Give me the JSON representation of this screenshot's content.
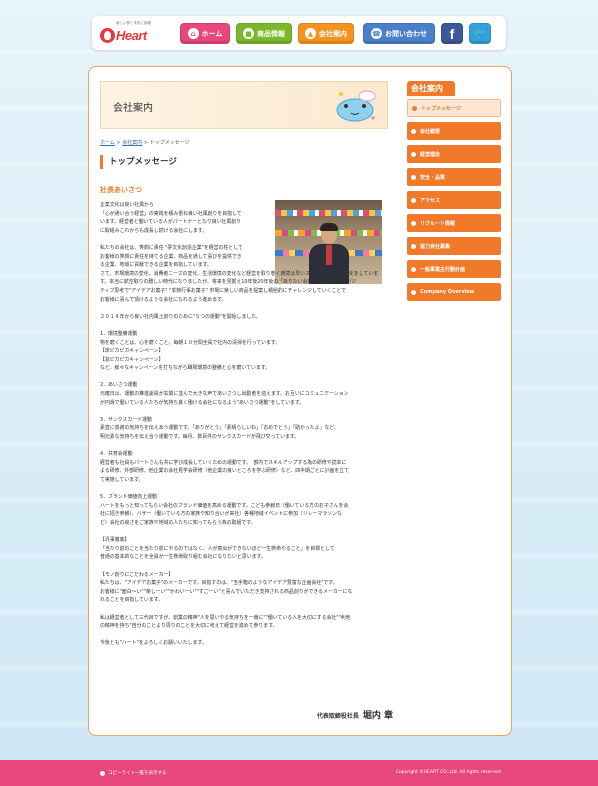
{
  "header": {
    "logo_tagline": "楽しい夢と未来に挑戦",
    "logo_text": "Heart",
    "nav": [
      {
        "label": "ホーム",
        "icon": "house-icon"
      },
      {
        "label": "商品情報",
        "icon": "box-icon"
      },
      {
        "label": "会社案内",
        "icon": "building-icon"
      },
      {
        "label": "お問い合わせ",
        "icon": "phone-icon"
      }
    ],
    "facebook_label": "f",
    "twitter_label": "t"
  },
  "page": {
    "title": "会社案内",
    "breadcrumb": [
      "ホーム",
      "会社案内",
      "トップメッセージ"
    ],
    "section_title": "トップメッセージ",
    "greeting_title": "社長あいさつ"
  },
  "message": {
    "intro_lines": [
      "企業文化は良い社風から",
      "「心が通い合う経営」の実践を積み重ね良い社風創りを目指して",
      "います。経営者と働いている人がパートナーとなり良い社風創り",
      "に取組みこれからも成長し続ける会社にします。"
    ],
    "vision_lines": [
      "私たちの会社は、笑顔に責任 \"夢文化創造企業\"を経営の柱として",
      "お客様の笑顔に責任を持てる企業、商品を通して喜びを提供でき",
      "る企業、地域に貢献できる企業を目指しています。",
      "さて、市場環境の変化、消費者ニーズの変化、生活環境の変化など経営を取り巻く環境は早いスピードで大きく変化をしていま",
      "す。本当に航空取りの難しい時代になりましたが、将来を見据え10年後20年後の「ありたい会社像」に向かってポジ",
      "ティブ思考で\"アイデアお菓子\" \"季節行事お菓子\" 市場に楽しい商品を提案し積極的にチャレンジしていくことで",
      "お客様に喜んで頂けるような会社になれるよう進めます。"
    ],
    "campaign_intro": "２０１４年から良い社内風土創りのために\"５つの運動\"を開始しました。",
    "movements": [
      {
        "title": "1．環境整備運動",
        "lines": [
          "物を磨くことは、心を磨くこと。毎朝１０分間全員で社内の清掃を行っています。",
          "【床ピカピカキャンペーン】",
          "【窓ピカピカキャンペーン】",
          "など、様々なキャンペーンを打ちながら職場環境の整備と心を磨いています。"
        ]
      },
      {
        "title": "2．あいさつ運動",
        "lines": [
          "元確日は、運動の推進委員が玄関に並んで大きな声であいさつし出勤者を迎えます。お互いにコミュニケーション",
          "が円滑で働いている人たちが気持ち良く働ける会社になるよう\"あいさつ運動\"をしています。"
        ]
      },
      {
        "title": "3．サンクスカード運動",
        "lines": [
          "素直に感謝の気持ちを伝えあう運動です。「ありがとう」「素晴らしいね」「おめでとう」「助かったよ」など、",
          "明元素な気持ちを伝え合う運動です。毎月、数百件のサンクスカードが飛び交っています。"
        ]
      },
      {
        "title": "4．共育会運動",
        "lines": [
          "経営者も社員もパートさんも共に学び成長していくための運動です。　部内でスキルアップする為の研修や読本に",
          "よる研修、外部研修、他企業の会社見学会研修（他企業の良いところを学ぶ研修）など、四半期ごとに計画を立て",
          "て実施しています。"
        ]
      },
      {
        "title": "5．ブランド価値向上運動",
        "lines": [
          "ハートをもっと知ってもらい会社のブランド価値を高める運動です。こども参観日（働いている方のお子さんを会",
          "社に招き参観）、バザー（働いている方の家族や知り合いが来社）各種地域イベントに参加（リレーマラソンな",
          "ど）会社の良さをご家族や地域の人たちに知ってもらう為の取組です。"
        ]
      }
    ],
    "motto_blocks": [
      {
        "title": "【汎事徹底】",
        "lines": [
          "「当たり前のことを当たり前にやるのではなく、人が真似ができないほど一生懸命やること」を目標として",
          "普通の基本的なことを全員が一生懸命取り組む会社になりたいと思います。"
        ]
      },
      {
        "title": "【モノ創りにこだわるメーカー】",
        "lines": [
          "私たちは、\"アイデアお菓子\"のメーカーです。目指すのは、\"玉手箱のようなアイデア豊富な企画会社\"です。",
          "お客様に\"面白〜い\"\"楽しーい\"\"かわいーい\"\"すごーい\"と喜んでいただき支持される商品創りができるメーカーにな",
          "れることを目指しています。"
        ]
      }
    ],
    "closing_lines": [
      "私は経営者として三代目ですが、創業の精神\"人を思いやる気持ちを一番に\"\"働いている人を大切にする会社\"\"利他",
      "の精神を持ち\"自分のことより周りのことを大切に考えて経営を進めて参ります。"
    ],
    "final_line": "今後とも\"ハート\"をよろしくお願いいたします。",
    "signature_title": "代表取締役社長",
    "signature_name": "堀内 章"
  },
  "sidebar": {
    "heading": "会社案内",
    "items": [
      {
        "label": "トップメッセージ",
        "active": true
      },
      {
        "label": "会社概要",
        "active": false
      },
      {
        "label": "経営理念",
        "active": false
      },
      {
        "label": "安全・品質",
        "active": false
      },
      {
        "label": "アクセス",
        "active": false
      },
      {
        "label": "リクルート情報",
        "active": false
      },
      {
        "label": "協力会社募集",
        "active": false
      },
      {
        "label": "一般事業主行動計画",
        "active": false
      },
      {
        "label": "Company Overview",
        "active": false
      }
    ]
  },
  "footer": {
    "link_label": "コピーライト一覧を表示する",
    "copyright": "Copyright ©HEART CO.,Ltd. All rights reserved."
  },
  "colors": {
    "accent_orange": "#f07a2a",
    "home_pink": "#e8477c",
    "product_green": "#7bb829",
    "company_orange": "#f39421",
    "contact_blue": "#4b7fc9",
    "facebook_blue": "#3b5998",
    "twitter_blue": "#34a2d9",
    "footer_pink": "#e8477c"
  }
}
